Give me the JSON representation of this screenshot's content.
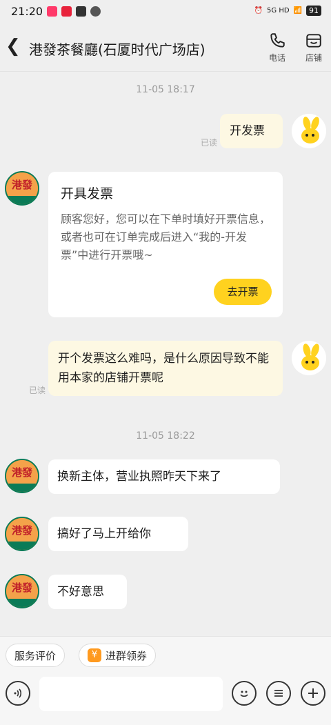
{
  "status_bar": {
    "time": "21:20",
    "network": "5G HD",
    "battery": "91"
  },
  "header": {
    "title": "港發茶餐廳(石厦时代广场店)",
    "phone_label": "电话",
    "shop_label": "店铺"
  },
  "messages": {
    "ts1": "11-05 18:17",
    "m1_text": "开发票",
    "m1_read": "已读",
    "card_title": "开具发票",
    "card_body": "顾客您好，您可以在下单时填好开票信息，或者也可在订单完成后进入“我的-开发票”中进行开票哦~",
    "card_button": "去开票",
    "m2_text": "开个发票这么难吗，是什么原因导致不能用本家的店铺开票呢",
    "m2_read": "已读",
    "ts2": "11-05 18:22",
    "r1": "换新主体，营业执照昨天下来了",
    "r2": "搞好了马上开给你",
    "r3": "不好意思"
  },
  "shop_avatar_text": "港發",
  "bottom_bar": {
    "chip_review": "服务评价",
    "chip_group": "进群领券",
    "chip_group_icon": "¥"
  },
  "colors": {
    "accent": "#ffd21f",
    "my_bubble": "#fdf8e3",
    "background": "#efefef"
  }
}
